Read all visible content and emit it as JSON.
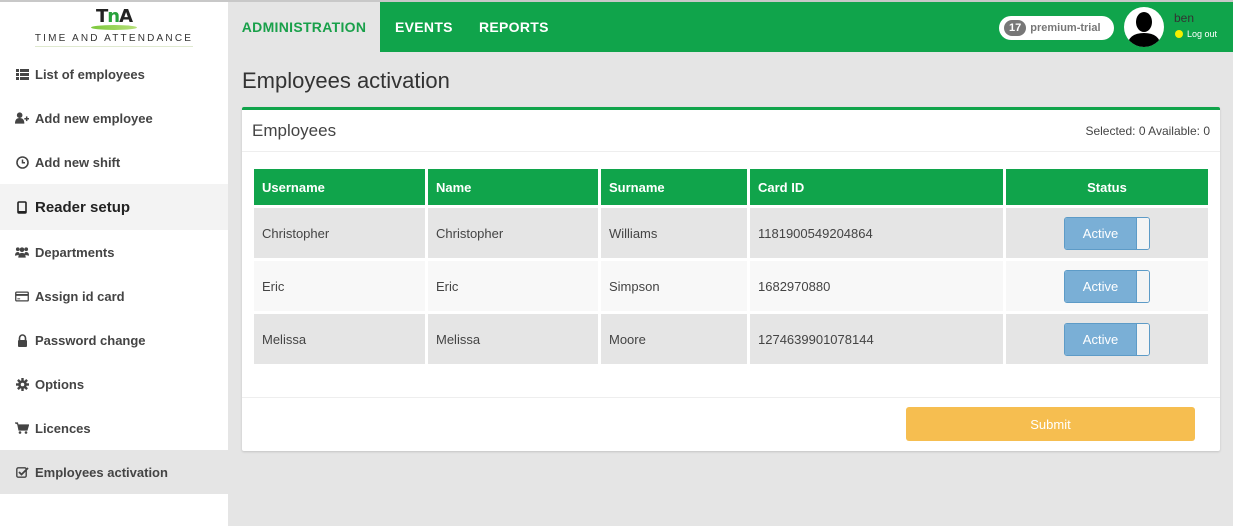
{
  "app": {
    "logo_mark": "TnA",
    "logo_text": "TIME AND ATTENDANCE"
  },
  "header": {
    "tabs": [
      {
        "label": "ADMINISTRATION",
        "active": true
      },
      {
        "label": "EVENTS",
        "active": false
      },
      {
        "label": "REPORTS",
        "active": false
      }
    ],
    "badge_count": "17",
    "badge_label": "premium-trial",
    "user_name": "ben",
    "logout_label": "Log out"
  },
  "sidebar": {
    "items": [
      {
        "label": "List of employees",
        "icon": "list-icon"
      },
      {
        "label": "Add new employee",
        "icon": "user-plus-icon"
      },
      {
        "label": "Add new shift",
        "icon": "clock-icon"
      },
      {
        "label": "Reader setup",
        "icon": "tablet-icon"
      },
      {
        "label": "Departments",
        "icon": "users-icon"
      },
      {
        "label": "Assign id card",
        "icon": "credit-card-icon"
      },
      {
        "label": "Password change",
        "icon": "lock-icon"
      },
      {
        "label": "Options",
        "icon": "gear-icon"
      },
      {
        "label": "Licences",
        "icon": "cart-icon"
      },
      {
        "label": "Employees activation",
        "icon": "check-square-icon",
        "active": true
      }
    ]
  },
  "main": {
    "page_title": "Employees activation",
    "panel_title": "Employees",
    "panel_stat": "Selected: 0 Available: 0",
    "columns": [
      "Username",
      "Name",
      "Surname",
      "Card ID",
      "Status"
    ],
    "rows": [
      {
        "username": "Christopher",
        "name": "Christopher",
        "surname": "Williams",
        "card_id": "1181900549204864",
        "status": "Active"
      },
      {
        "username": "Eric",
        "name": "Eric",
        "surname": "Simpson",
        "card_id": "1682970880",
        "status": "Active"
      },
      {
        "username": "Melissa",
        "name": "Melissa",
        "surname": "Moore",
        "card_id": "1274639901078144",
        "status": "Active"
      }
    ],
    "submit_label": "Submit"
  },
  "colors": {
    "brand_green": "#10a44b",
    "submit_yellow": "#f6be50",
    "toggle_blue": "#7aafd6"
  }
}
